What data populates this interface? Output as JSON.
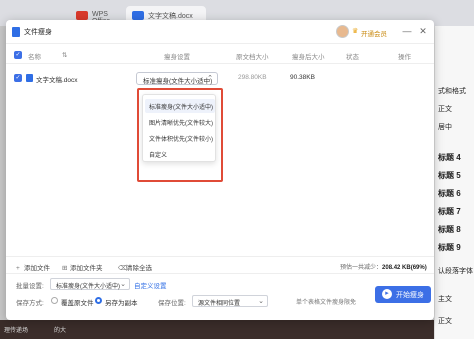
{
  "background": {
    "tabs": [
      {
        "label": "WPS Office"
      },
      {
        "label": "文字文稿.docx"
      }
    ],
    "right_panel": [
      "式和格式",
      "正文",
      "居中",
      "标题 4",
      "标题 5",
      "标题 6",
      "标题 7",
      "标题 8",
      "标题 9",
      "认段落字体",
      "主文",
      "正文"
    ],
    "bottom": [
      "理传递场",
      "的大"
    ]
  },
  "dialog": {
    "title": "文件瘦身",
    "member_label": "开通会员",
    "vip_icon": "♛",
    "minimize": "—",
    "close": "✕"
  },
  "table": {
    "headers": {
      "name": "名称",
      "opt": "瘦身设置",
      "orig": "原文档大小",
      "after": "瘦身后大小",
      "status": "状态",
      "action": "操作"
    },
    "rows": [
      {
        "checked": true,
        "name": "文字文稿.docx",
        "setting": "标准瘦身(文件大小适中)",
        "orig_size": "298.80KB",
        "after_size": "90.38KB",
        "status": "",
        "action": ""
      }
    ]
  },
  "dropdown": {
    "options": [
      "标准瘦身(文件大小适中)",
      "图片清晰优先(文件较大)",
      "文件体积优先(文件较小)",
      "自定义"
    ],
    "selected_index": 0
  },
  "toolbar": {
    "add_file": "添加文件",
    "add_folder": "添加文件夹",
    "clear_all": "清除全选",
    "summary_prefix": "预估一共减少：",
    "summary_value": "208.42 KB(69%)"
  },
  "settings": {
    "batch_label": "批量设置:",
    "batch_value": "标准瘦身(文件大小适中)",
    "custom_link": "自定义设置",
    "save_mode_label": "保存方式:",
    "overwrite_label": "覆盖原文件",
    "save_as_label": "另存为副本",
    "save_as_selected": true,
    "save_pos_label": "保存位置:",
    "save_pos_value": "源文件相同位置",
    "note": "单个表格文件瘦身限免",
    "start_button": "开始瘦身"
  }
}
